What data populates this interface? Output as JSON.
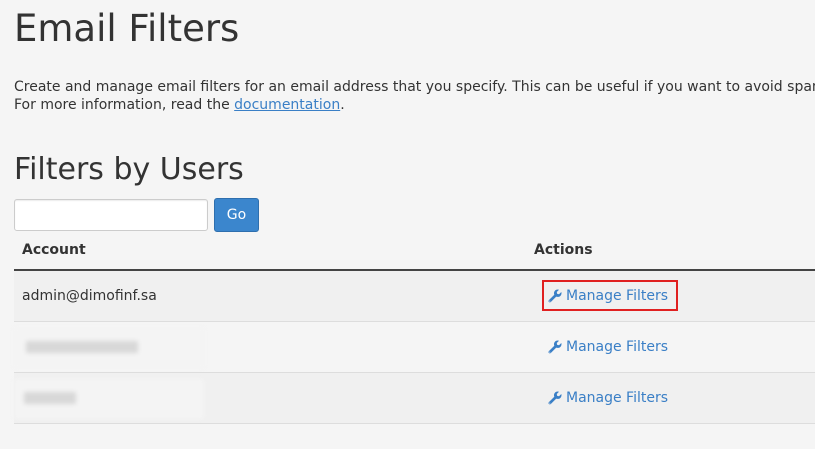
{
  "page": {
    "title": "Email Filters",
    "description_line1": "Create and manage email filters for an email address that you specify. This can be useful if you want to avoid spam, redirect",
    "description_line2_prefix": "For more information, read the ",
    "documentation_link": "documentation",
    "description_line2_suffix": "."
  },
  "filters_section": {
    "title": "Filters by Users",
    "search": {
      "value": "",
      "placeholder": ""
    },
    "go_label": "Go"
  },
  "table": {
    "columns": [
      "Account",
      "Actions"
    ],
    "rows": [
      {
        "account": "admin@dimofinf.sa",
        "action": "Manage Filters",
        "highlighted": true,
        "redacted": false
      },
      {
        "account": "",
        "action": "Manage Filters",
        "highlighted": false,
        "redacted": true
      },
      {
        "account": "",
        "action": "Manage Filters",
        "highlighted": false,
        "redacted": true
      }
    ]
  },
  "colors": {
    "link": "#3a7fc6",
    "primary_button": "#3b86cd",
    "highlight_border": "#e02020"
  },
  "icons": {
    "action": "wrench-icon"
  }
}
